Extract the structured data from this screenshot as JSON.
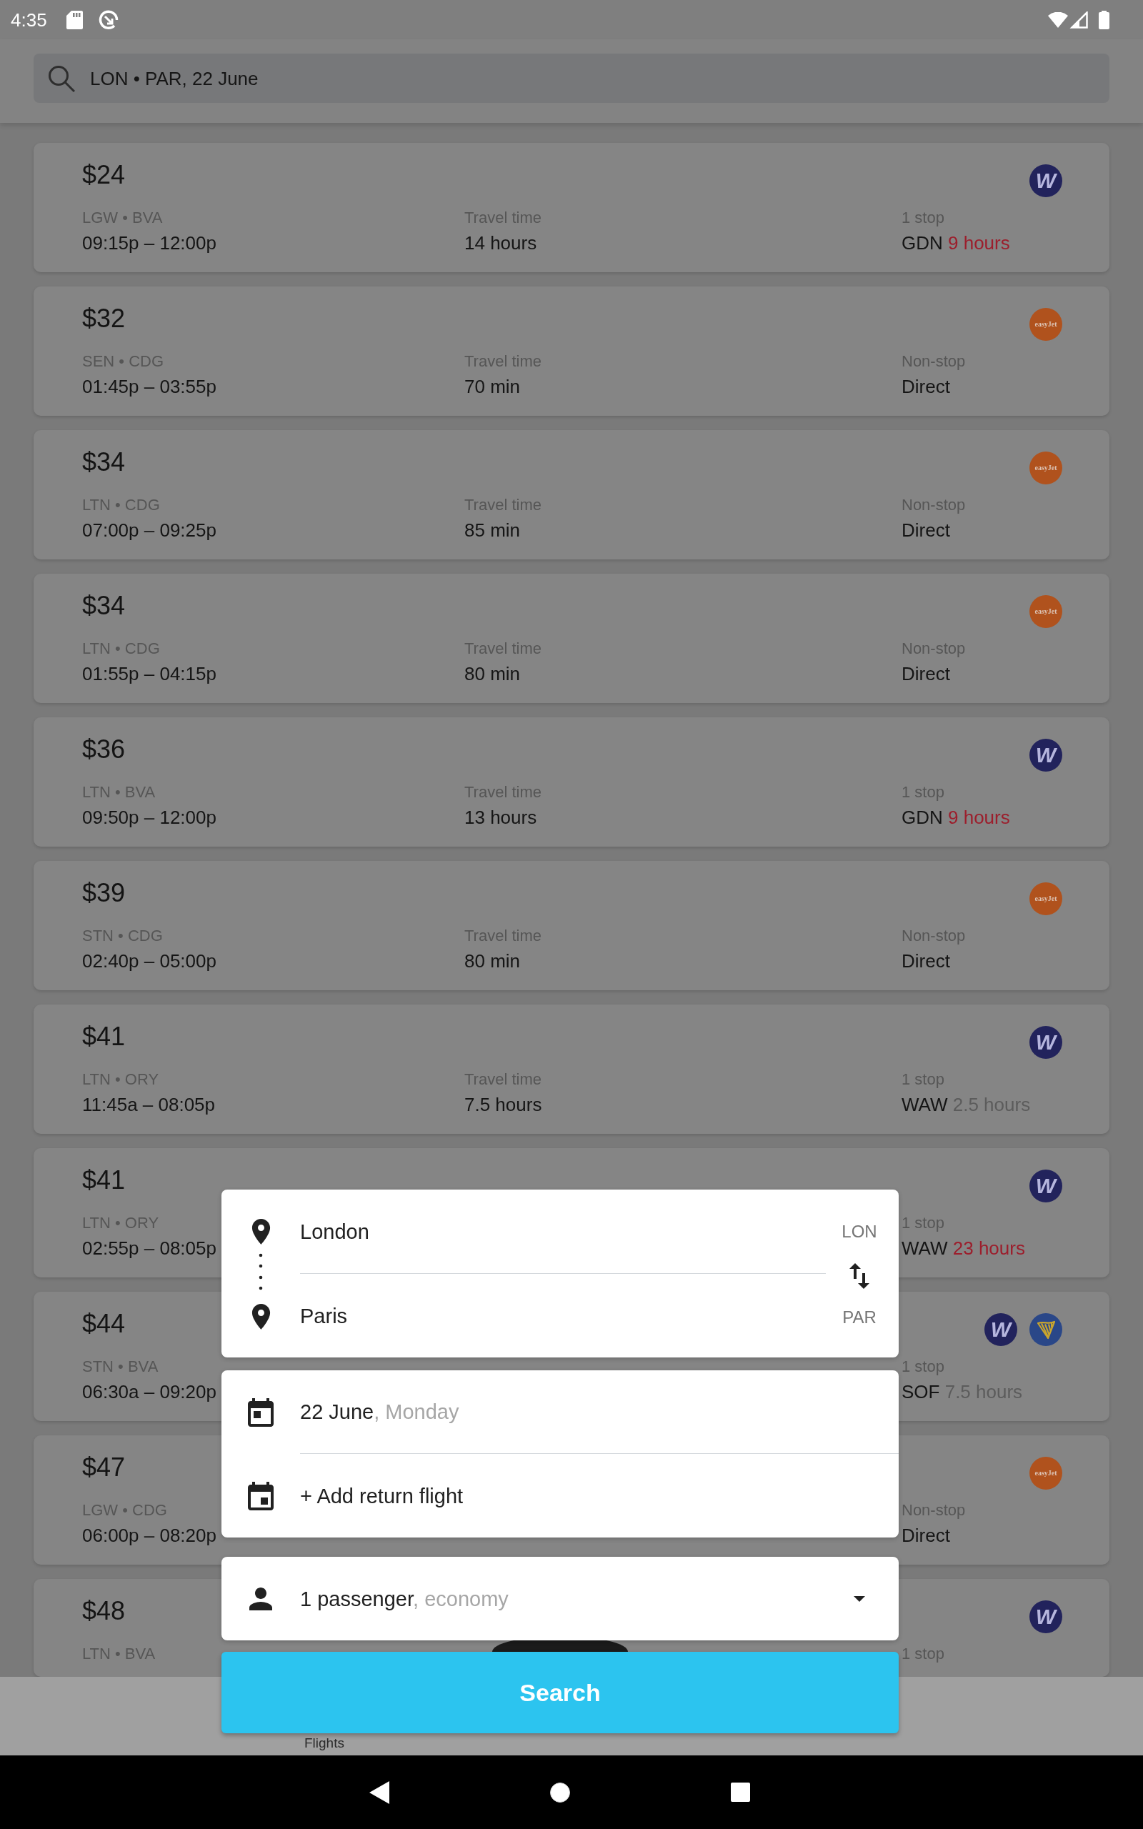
{
  "status_bar": {
    "time": "4:35"
  },
  "search_bar": {
    "value": "LON • PAR, 22 June"
  },
  "flights": [
    {
      "price": "$24",
      "route": "LGW • BVA",
      "times": "09:15p – 12:00p",
      "travel_label": "Travel time",
      "travel_time": "14 hours",
      "stops": {
        "label": "1 stop",
        "via": "GDN",
        "layover": "9 hours",
        "long_layover": true
      },
      "airlines": [
        {
          "kind": "w",
          "text": "W"
        }
      ]
    },
    {
      "price": "$32",
      "route": "SEN • CDG",
      "times": "01:45p – 03:55p",
      "travel_label": "Travel time",
      "travel_time": "70 min",
      "stops": {
        "label": "Non-stop",
        "via": "Direct"
      },
      "airlines": [
        {
          "kind": "easyjet",
          "text": "easyJet"
        }
      ]
    },
    {
      "price": "$34",
      "route": "LTN • CDG",
      "times": "07:00p – 09:25p",
      "travel_label": "Travel time",
      "travel_time": "85 min",
      "stops": {
        "label": "Non-stop",
        "via": "Direct"
      },
      "airlines": [
        {
          "kind": "easyjet",
          "text": "easyJet"
        }
      ]
    },
    {
      "price": "$34",
      "route": "LTN • CDG",
      "times": "01:55p – 04:15p",
      "travel_label": "Travel time",
      "travel_time": "80 min",
      "stops": {
        "label": "Non-stop",
        "via": "Direct"
      },
      "airlines": [
        {
          "kind": "easyjet",
          "text": "easyJet"
        }
      ]
    },
    {
      "price": "$36",
      "route": "LTN • BVA",
      "times": "09:50p – 12:00p",
      "travel_label": "Travel time",
      "travel_time": "13 hours",
      "stops": {
        "label": "1 stop",
        "via": "GDN",
        "layover": "9 hours",
        "long_layover": true
      },
      "airlines": [
        {
          "kind": "w",
          "text": "W"
        }
      ]
    },
    {
      "price": "$39",
      "route": "STN • CDG",
      "times": "02:40p – 05:00p",
      "travel_label": "Travel time",
      "travel_time": "80 min",
      "stops": {
        "label": "Non-stop",
        "via": "Direct"
      },
      "airlines": [
        {
          "kind": "easyjet",
          "text": "easyJet"
        }
      ]
    },
    {
      "price": "$41",
      "route": "LTN • ORY",
      "times": "11:45a – 08:05p",
      "travel_label": "Travel time",
      "travel_time": "7.5 hours",
      "stops": {
        "label": "1 stop",
        "via": "WAW",
        "layover": "2.5 hours",
        "long_layover": false
      },
      "airlines": [
        {
          "kind": "w",
          "text": "W"
        }
      ]
    },
    {
      "price": "$41",
      "route": "LTN • ORY",
      "times": "02:55p – 08:05p",
      "stops": {
        "label": "1 stop",
        "via": "WAW",
        "layover": "23 hours",
        "long_layover": true
      },
      "airlines": [
        {
          "kind": "w",
          "text": "W"
        }
      ]
    },
    {
      "price": "$44",
      "route": "STN • BVA",
      "times": "06:30a – 09:20p",
      "stops": {
        "label": "1 stop",
        "via": "SOF",
        "layover": "7.5 hours",
        "long_layover": false
      },
      "airlines": [
        {
          "kind": "w",
          "text": "W"
        },
        {
          "kind": "harp"
        }
      ]
    },
    {
      "price": "$47",
      "route": "LGW • CDG",
      "times": "06:00p – 08:20p",
      "stops": {
        "label": "Non-stop",
        "via": "Direct"
      },
      "airlines": [
        {
          "kind": "easyjet",
          "text": "easyJet"
        }
      ]
    },
    {
      "price": "$48",
      "route": "LTN • BVA",
      "stops": {
        "label": "1 stop"
      },
      "airlines": [
        {
          "kind": "w",
          "text": "W"
        }
      ]
    }
  ],
  "trip_form": {
    "origin": {
      "city": "London",
      "code": "LON"
    },
    "destination": {
      "city": "Paris",
      "code": "PAR"
    },
    "date": {
      "value": "22 June",
      "weekday": ", Monday"
    },
    "return": {
      "label": "+ Add return flight"
    },
    "passengers": {
      "value": "1 passenger",
      "cabin": ", economy"
    },
    "search_button": "Search"
  },
  "bottom_nav": {
    "items": [
      {
        "label": "Flights"
      }
    ]
  }
}
